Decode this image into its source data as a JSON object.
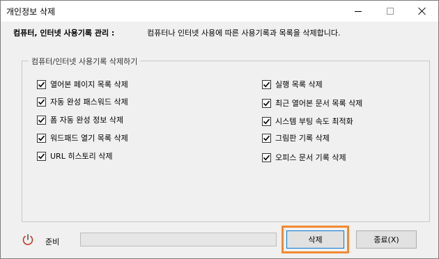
{
  "window": {
    "title": "개인정보 삭제"
  },
  "header": {
    "label": "컴퓨터, 인터넷 사용기록 관리 :",
    "description": "컴퓨터나 인터넷 사용에 따른 사용기록과 목록을 삭제합니다."
  },
  "group": {
    "legend": "컴퓨터/인터넷 사용기록 삭제하기",
    "left": [
      {
        "label": "열어본 페이지 목록 삭제",
        "checked": true
      },
      {
        "label": "자동 완성 패스워드 삭제",
        "checked": true
      },
      {
        "label": "폼 자동 완성 정보 삭제",
        "checked": true
      },
      {
        "label": "워드패드 열기 목록 삭제",
        "checked": true
      },
      {
        "label": "URL 히스토리 삭제",
        "checked": true
      }
    ],
    "right": [
      {
        "label": "실행 목록 삭제",
        "checked": true
      },
      {
        "label": "최근 열어본 문서 목록 삭제",
        "checked": true
      },
      {
        "label": "시스템 부팅 속도 최적화",
        "checked": true
      },
      {
        "label": "그림판 기록 삭제",
        "checked": true
      },
      {
        "label": "오피스 문서 기록 삭제",
        "checked": true
      }
    ]
  },
  "status": {
    "text": "준비",
    "progress": 0
  },
  "buttons": {
    "delete": "삭제",
    "close": "종료(X)"
  },
  "colors": {
    "highlight": "#f28a30",
    "default_button_border": "#0078d7"
  }
}
